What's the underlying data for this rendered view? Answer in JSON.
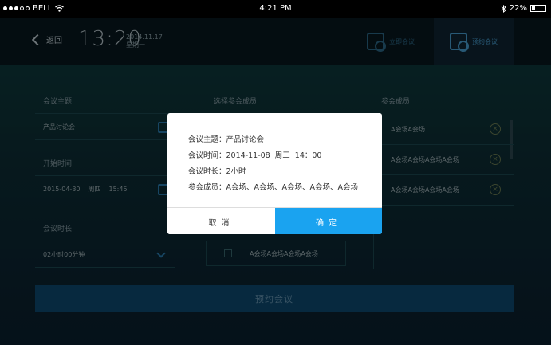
{
  "statusbar": {
    "carrier": "BELL",
    "time": "4:21 PM",
    "battery": "22%",
    "battery_level": 0.22
  },
  "header": {
    "back_label": "返回",
    "clock": "13:20",
    "date": "2014.11.17",
    "weekday": "星期一",
    "tabs": [
      {
        "label": "立即会议",
        "active": false
      },
      {
        "label": "预约会议",
        "active": true
      }
    ]
  },
  "form": {
    "topic_label": "会议主题",
    "topic_value": "产品讨论会",
    "start_label": "开始时间",
    "start_date": "2015-04-30",
    "start_weekday": "周四",
    "start_time": "15:45",
    "duration_label": "会议时长",
    "duration_value": "02小时00分钟"
  },
  "select_members": {
    "label": "选择参会成员",
    "visible_row": "A会场A会场A会场A会场"
  },
  "members": {
    "label": "参会成员",
    "items": [
      "A会场A会场",
      "A会场A会场A会场A会场",
      "A会场A会场A会场A会场"
    ]
  },
  "book_button": "预约会议",
  "dialog": {
    "topic_key": "会议主题：",
    "topic_val": "产品讨论会",
    "time_key": "会议时间：",
    "time_val": "2014-11-08  周三  14：00",
    "duration_key": "会议时长：",
    "duration_val": "2小时",
    "members_key": "参会成员：",
    "members_val": "A会场、A会场、A会场、A会场、A会场",
    "cancel": "取消",
    "confirm": "确定"
  },
  "colors": {
    "accent": "#1aa3f0",
    "book_button": "#0e4c73",
    "background": "#0a1e27"
  }
}
